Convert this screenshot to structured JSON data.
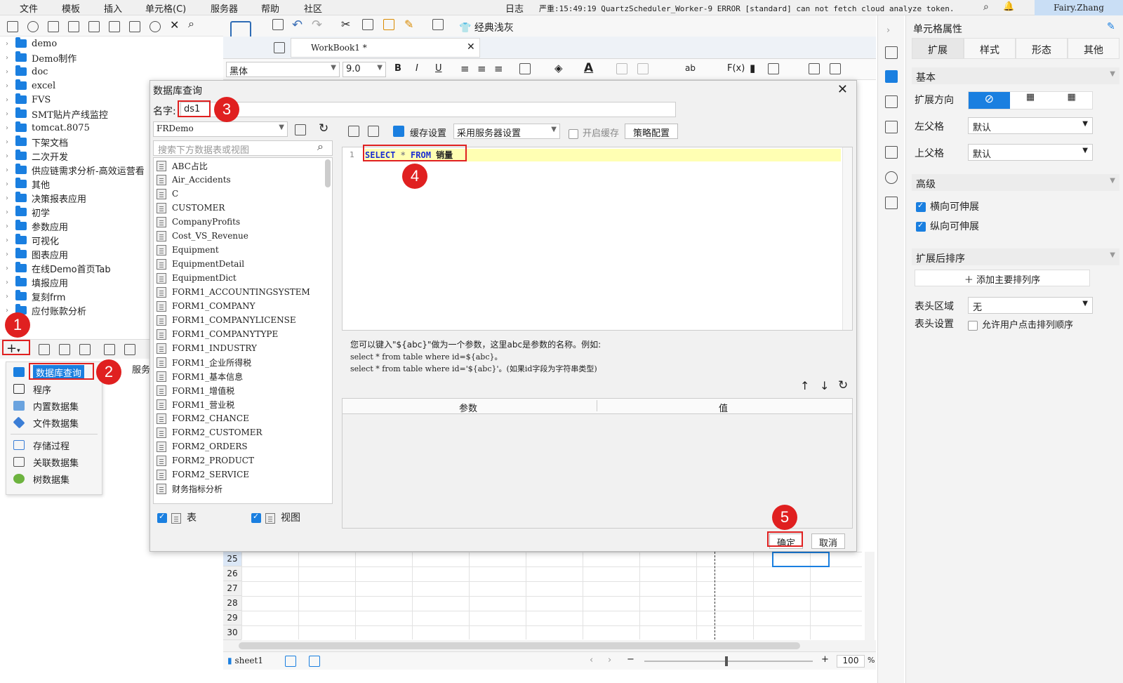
{
  "menubar": {
    "items": [
      "文件",
      "模板",
      "插入",
      "单元格(C)",
      "服务器",
      "帮助",
      "社区"
    ],
    "log_label": "日志",
    "log_text": "严重:15:49:19 QuartzScheduler_Worker-9 ERROR [standard] can not fetch cloud analyze token.",
    "user": "Fairy.Zhang"
  },
  "tree": {
    "items": [
      "demo",
      "Demo制作",
      "doc",
      "excel",
      "FVS",
      "SMT贴片产线监控",
      "tomcat.8075",
      "下架文档",
      "二次开发",
      "供应链需求分析-高效运营看",
      "其他",
      "决策报表应用",
      "初学",
      "参数应用",
      "可视化",
      "图表应用",
      "在线Demo首页Tab",
      "填报应用",
      "复刻frm",
      "应付账款分析"
    ]
  },
  "ds_menu": {
    "items": [
      "数据库查询",
      "程序",
      "内置数据集",
      "文件数据集",
      "存储过程",
      "关联数据集",
      "树数据集"
    ],
    "server_tab": "服务"
  },
  "designer": {
    "tab_label": "WorkBook1 *",
    "theme_label": "经典浅灰",
    "font_name": "黑体",
    "font_size": "9.0"
  },
  "dialog": {
    "title": "数据库查询",
    "name_label": "名字:",
    "name_value": "ds1",
    "connection": "FRDemo",
    "search_placeholder": "搜索下方数据表或视图",
    "cache_label": "缓存设置",
    "cache_mode": "采用服务器设置",
    "enable_cache": "开启缓存",
    "policy": "策略配置",
    "line_no": "1",
    "sql_select": "SELECT",
    "sql_star": " * ",
    "sql_from": "FROM",
    "sql_table": " 销量",
    "hint1": "您可以键入\"${abc}\"做为一个参数，这里abc是参数的名称。例如:",
    "hint2": "select * from table where id=${abc}。",
    "hint3": "select * from table where id='${abc}'。(如果id字段为字符串类型)",
    "param_col": "参数",
    "value_col": "值",
    "tables": [
      "ABC占比",
      "Air_Accidents",
      "C",
      "CUSTOMER",
      "CompanyProfits",
      "Cost_VS_Revenue",
      "Equipment",
      "EquipmentDetail",
      "EquipmentDict",
      "FORM1_ACCOUNTINGSYSTEM",
      "FORM1_COMPANY",
      "FORM1_COMPANYLICENSE",
      "FORM1_COMPANYTYPE",
      "FORM1_INDUSTRY",
      "FORM1_企业所得税",
      "FORM1_基本信息",
      "FORM1_增值税",
      "FORM1_营业税",
      "FORM2_CHANCE",
      "FORM2_CUSTOMER",
      "FORM2_ORDERS",
      "FORM2_PRODUCT",
      "FORM2_SERVICE",
      "财务指标分析"
    ],
    "show_table": "表",
    "show_view": "视图",
    "ok": "确定",
    "cancel": "取消"
  },
  "badges": [
    "1",
    "2",
    "3",
    "4",
    "5"
  ],
  "grid": {
    "rows": [
      "25",
      "26",
      "27",
      "28",
      "29",
      "30"
    ]
  },
  "status": {
    "sheet": "sheet1",
    "zoom": "100",
    "percent": "%"
  },
  "props": {
    "title": "单元格属性",
    "tabs": [
      "扩展",
      "样式",
      "形态",
      "其他"
    ],
    "basic": "基本",
    "expand_dir": "扩展方向",
    "left_parent": "左父格",
    "left_parent_val": "默认",
    "top_parent": "上父格",
    "top_parent_val": "默认",
    "advanced": "高级",
    "h_expand": "横向可伸展",
    "v_expand": "纵向可伸展",
    "sort_after": "扩展后排序",
    "add_sort": "添加主要排列序",
    "header_area": "表头区域",
    "header_area_val": "无",
    "header_set": "表头设置",
    "allow_sort": "允许用户点击排列顺序"
  },
  "colors": {
    "accent": "#1a7fe0",
    "highlight": "#e02020",
    "sql_line": "#ffffb3"
  }
}
